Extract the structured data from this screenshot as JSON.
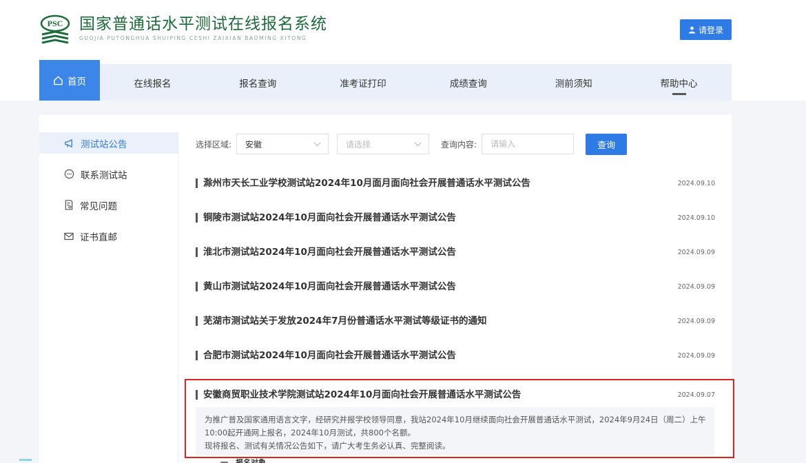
{
  "header": {
    "logo_mark_text": "PSC",
    "title": "国家普通话水平测试在线报名系统",
    "subtitle": "GUOJIA PUTONGHUA SHUIPING CESHI ZAIXIAN BAOMING XITONG",
    "login_label": "请登录"
  },
  "nav": {
    "items": [
      {
        "label": "首页"
      },
      {
        "label": "在线报名"
      },
      {
        "label": "报名查询"
      },
      {
        "label": "准考证打印"
      },
      {
        "label": "成绩查询"
      },
      {
        "label": "测前须知"
      },
      {
        "label": "帮助中心"
      }
    ]
  },
  "sidebar": {
    "items": [
      {
        "label": "测试站公告",
        "icon": "megaphone-icon"
      },
      {
        "label": "联系测试站",
        "icon": "chat-icon"
      },
      {
        "label": "常见问题",
        "icon": "document-search-icon"
      },
      {
        "label": "证书直邮",
        "icon": "mail-icon"
      }
    ]
  },
  "filters": {
    "region_label": "选择区域:",
    "province_value": "安徽",
    "city_placeholder": "请选择",
    "query_label": "查询内容:",
    "query_placeholder": "请输入",
    "query_button": "查询"
  },
  "announcements": [
    {
      "title": "滁州市天长工业学校测试站2024年10月面月面向社会开展普通话水平测试公告",
      "date": "2024.09.10"
    },
    {
      "title": "铜陵市测试站2024年10月面向社会开展普通话水平测试公告",
      "date": "2024.09.10"
    },
    {
      "title": "淮北市测试站2024年10月面向社会开展普通话水平测试公告",
      "date": "2024.09.09"
    },
    {
      "title": "黄山市测试站2024年10月面向社会开展普通话水平测试公告",
      "date": "2024.09.09"
    },
    {
      "title": "芜湖市测试站关于发放2024年7月份普通话水平测试等级证书的通知",
      "date": "2024.09.09"
    },
    {
      "title": "合肥市测试站2024年10月面向社会开展普通话水平测试公告",
      "date": "2024.09.09"
    }
  ],
  "highlighted": {
    "title": "安徽商贸职业技术学院测试站2024年10月面向社会开展普通话水平测试公告",
    "date": "2024.09.07",
    "excerpt_line1": "为推广普及国家通用语言文字，经研究并报学校领导同意，我站2024年10月继续面向社会开展普通话水平测试，2024年9月24日（周二）上午10:00起开通网上报名，2024年10月测试，共800个名额。",
    "excerpt_line2": "现将报名、测试有关情况公告如下，请广大考生务必认真、完整阅读。",
    "cutoff_text": "一、报名对象"
  },
  "colors": {
    "primary": "#2f7be6",
    "logo_green": "#1d6b3a",
    "highlight_border": "#d8231f"
  }
}
